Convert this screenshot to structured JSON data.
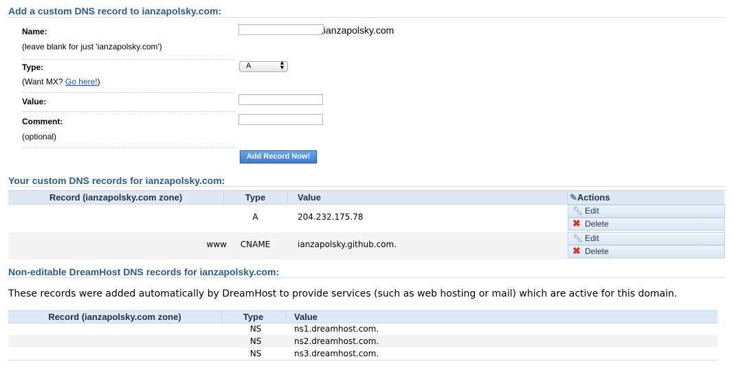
{
  "add_form": {
    "title": "Add a custom DNS record to ianzapolsky.com:",
    "name_label": "Name:",
    "name_hint": "(leave blank for just 'ianzapolsky.com')",
    "name_value": "",
    "name_suffix": ".ianzapolsky.com",
    "type_label": "Type:",
    "type_selected": "A",
    "type_hint_prefix": "(Want MX?",
    "type_hint_link": "Go here!",
    "type_hint_suffix": ")",
    "value_label": "Value:",
    "value_value": "",
    "comment_label": "Comment:",
    "comment_hint": "(optional)",
    "comment_value": "",
    "submit_label": "Add Record Now!"
  },
  "custom_records": {
    "title": "Your custom DNS records for ianzapolsky.com:",
    "columns": [
      "Record (ianzapolsky.com zone)",
      "Type",
      "Value",
      "Actions"
    ],
    "edit_label": "Edit",
    "delete_label": "Delete",
    "rows": [
      {
        "record": "",
        "type": "A",
        "value": "204.232.175.78"
      },
      {
        "record": "www",
        "type": "CNAME",
        "value": "ianzapolsky.github.com."
      }
    ]
  },
  "dreamhost_records": {
    "title": "Non-editable DreamHost DNS records for ianzapolsky.com:",
    "description": "These records were added automatically by DreamHost to provide services (such as web hosting or mail) which are active for this domain.",
    "columns": [
      "Record (ianzapolsky.com zone)",
      "Type",
      "Value"
    ],
    "rows": [
      {
        "record": "",
        "type": "NS",
        "value": "ns1.dreamhost.com."
      },
      {
        "record": "",
        "type": "NS",
        "value": "ns2.dreamhost.com."
      },
      {
        "record": "",
        "type": "NS",
        "value": "ns3.dreamhost.com."
      }
    ]
  },
  "icons": {
    "wrench": "wrench-icon",
    "delete": "x-icon",
    "select_arrows": "updown-arrows-icon"
  },
  "colors": {
    "section_title": "#2f5a8a",
    "header_bg": "#dfe9f5",
    "button_blue": "#3a7ad6",
    "delete_red": "#d8342a",
    "link": "#1d4fb6"
  }
}
